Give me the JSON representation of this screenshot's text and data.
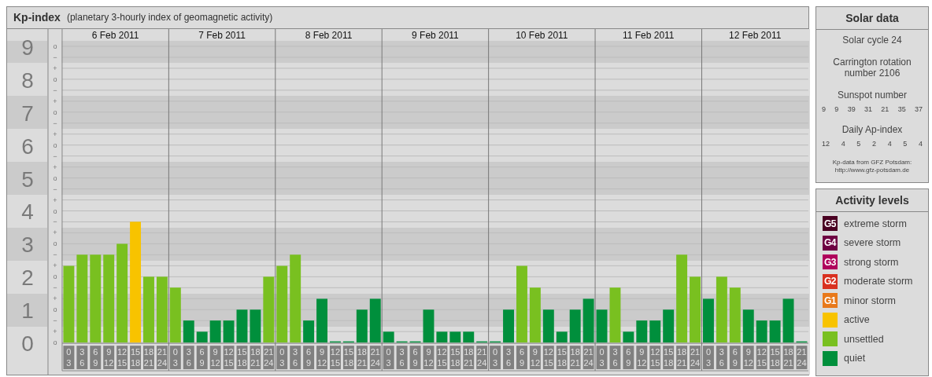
{
  "kp_panel": {
    "title": "Kp-index",
    "subtitle": "(planetary 3-hourly index of geomagnetic activity)",
    "dates": [
      "6 Feb 2011",
      "7 Feb 2011",
      "8 Feb 2011",
      "9 Feb 2011",
      "10 Feb 2011",
      "11 Feb 2011",
      "12 Feb 2011"
    ],
    "scale_marks": [
      "o",
      "−",
      "+",
      "o",
      "−",
      "+",
      "o",
      "−",
      "+",
      "o",
      "−",
      "+",
      "o",
      "−",
      "+",
      "o",
      "−",
      "+",
      "o",
      "−",
      "+",
      "o",
      "−",
      "+",
      "o",
      "−",
      "+",
      "o"
    ],
    "chart_data": {
      "type": "bar",
      "grid": true,
      "ylim": [
        0,
        9
      ],
      "categories": [
        "0 3",
        "3 6",
        "6 9",
        "9 12",
        "12 15",
        "15 18",
        "18 21",
        "21 24",
        "0 3",
        "3 6",
        "6 9",
        "9 12",
        "12 15",
        "15 18",
        "18 21",
        "21 24",
        "0 3",
        "3 6",
        "6 9",
        "9 12",
        "12 15",
        "15 18",
        "18 21",
        "21 24",
        "0 3",
        "3 6",
        "6 9",
        "9 12",
        "12 15",
        "15 18",
        "18 21",
        "21 24",
        "0 3",
        "3 6",
        "6 9",
        "9 12",
        "12 15",
        "15 18",
        "18 21",
        "21 24",
        "0 3",
        "3 6",
        "6 9",
        "9 12",
        "12 15",
        "15 18",
        "18 21",
        "21 24",
        "0 3",
        "3 6",
        "6 9",
        "9 12",
        "12 15",
        "15 18",
        "18 21",
        "21 24"
      ],
      "yticks": [
        9,
        8,
        7,
        6,
        5,
        4,
        3,
        2,
        1,
        0
      ],
      "series": [
        {
          "color": "#008f3c",
          "values": [
            null,
            null,
            null,
            null,
            null,
            null,
            null,
            null,
            null,
            0.67,
            0.33,
            0.67,
            0.67,
            1,
            1,
            null,
            null,
            null,
            0.67,
            1.33,
            0,
            0,
            1,
            1.33,
            0.33,
            0,
            0,
            1,
            0.33,
            0.33,
            0.33,
            0,
            0,
            1,
            null,
            null,
            1,
            0.33,
            1,
            1.33,
            1,
            null,
            0.33,
            0.67,
            0.67,
            1,
            null,
            null,
            1.33,
            null,
            null,
            1,
            0.67,
            0.67,
            1.33,
            0
          ]
        },
        {
          "color": "#79c020",
          "values": [
            2.33,
            2.67,
            2.67,
            2.67,
            3,
            null,
            2,
            2,
            1.67,
            null,
            null,
            null,
            null,
            null,
            null,
            2,
            2.33,
            2.67,
            null,
            null,
            null,
            null,
            null,
            null,
            null,
            null,
            null,
            null,
            null,
            null,
            null,
            null,
            null,
            null,
            2.33,
            1.67,
            null,
            null,
            null,
            null,
            null,
            1.67,
            null,
            null,
            null,
            null,
            2.67,
            2,
            null,
            2,
            1.67,
            null,
            null,
            null,
            null,
            null
          ]
        },
        {
          "color": "#f8c300",
          "values": [
            null,
            null,
            null,
            null,
            null,
            3.67,
            null,
            null,
            null,
            null,
            null,
            null,
            null,
            null,
            null,
            null,
            null,
            null,
            null,
            null,
            null,
            null,
            null,
            null,
            null,
            null,
            null,
            null,
            null,
            null,
            null,
            null,
            null,
            null,
            null,
            null,
            null,
            null,
            null,
            null,
            null,
            null,
            null,
            null,
            null,
            null,
            null,
            null,
            null,
            null,
            null,
            null,
            null,
            null,
            null,
            null
          ]
        }
      ]
    }
  },
  "solar_data": {
    "title": "Solar data",
    "solar_cycle": "Solar cycle 24",
    "carrington_rotation": "Carrington rotation number 2106",
    "sunspot_label": "Sunspot number",
    "sunspot_numbers": [
      "9",
      "9",
      "39",
      "31",
      "21",
      "35",
      "37"
    ],
    "ap_label": "Daily Ap-index",
    "ap_values": [
      "12",
      "4",
      "5",
      "2",
      "4",
      "5",
      "4"
    ],
    "source": "Kp-data from GFZ Potsdam:",
    "source_url": "http://www.gfz-potsdam.de"
  },
  "activity_levels": {
    "title": "Activity levels",
    "items": [
      {
        "badge": "G5",
        "label": "extreme storm",
        "color": "#4a0022"
      },
      {
        "badge": "G4",
        "label": "severe storm",
        "color": "#6e0042"
      },
      {
        "badge": "G3",
        "label": "strong storm",
        "color": "#b0005c"
      },
      {
        "badge": "G2",
        "label": "moderate storm",
        "color": "#d9301f"
      },
      {
        "badge": "G1",
        "label": "minor storm",
        "color": "#e8791a"
      },
      {
        "label": "active",
        "color": "#f8c300"
      },
      {
        "label": "unsettled",
        "color": "#79c020"
      },
      {
        "label": "quiet",
        "color": "#008f3c"
      }
    ]
  }
}
